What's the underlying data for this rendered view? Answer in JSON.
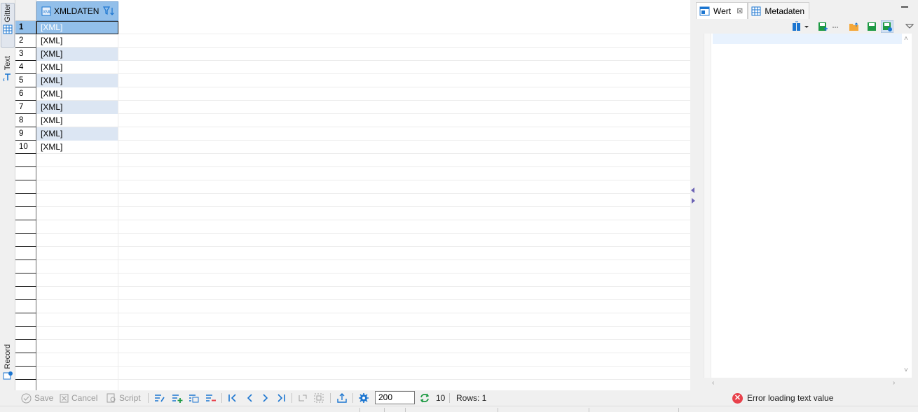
{
  "left_tabs": {
    "grid_label": "Gitter",
    "text_label": "Text",
    "record_label": "Record"
  },
  "grid": {
    "column_header": "XMLDATEN",
    "row_numbers": [
      "1",
      "2",
      "3",
      "4",
      "5",
      "6",
      "7",
      "8",
      "9",
      "10"
    ],
    "cells": [
      "[XML]",
      "[XML]",
      "[XML]",
      "[XML]",
      "[XML]",
      "[XML]",
      "[XML]",
      "[XML]",
      "[XML]",
      "[XML]"
    ],
    "selected_row": 1
  },
  "right_panel": {
    "tabs": [
      {
        "label": "Wert",
        "icon": "value-panel-icon",
        "active": true,
        "closable": true
      },
      {
        "label": "Metadaten",
        "icon": "metadata-grid-icon",
        "active": false
      }
    ],
    "close_glyph": "⊠"
  },
  "bottom_toolbar": {
    "save_label": "Save",
    "cancel_label": "Cancel",
    "script_label": "Script",
    "fetch_size": "200",
    "refresh_count": "10",
    "rows_label": "Rows: 1",
    "error_message": "Error loading text value"
  },
  "colors": {
    "accent": "#92bfea",
    "row_alt": "#dce6f3",
    "icon_blue": "#1b75d0",
    "icon_green": "#1e9a44",
    "error": "#e8414b"
  }
}
